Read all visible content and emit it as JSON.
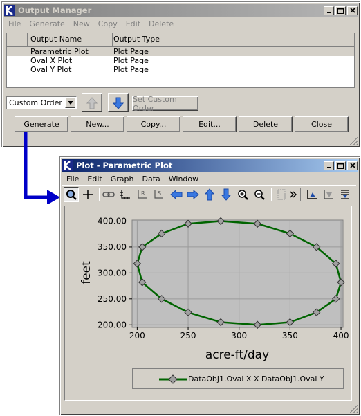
{
  "output_manager": {
    "title": "Output Manager",
    "menu": [
      "File",
      "Generate",
      "New",
      "Copy",
      "Edit",
      "Delete"
    ],
    "table": {
      "headers": [
        "Output Name",
        "Output Type"
      ],
      "rows": [
        {
          "name": "Parametric Plot",
          "type": "Plot Page"
        },
        {
          "name": "Oval X Plot",
          "type": "Plot Page"
        },
        {
          "name": "Oval Y Plot",
          "type": "Plot Page"
        }
      ]
    },
    "order_select": "Custom Order",
    "set_custom_order": "Set Custom Order",
    "buttons": {
      "generate": "Generate",
      "new": "New...",
      "copy": "Copy...",
      "edit": "Edit...",
      "delete": "Delete",
      "close": "Close"
    }
  },
  "plot_window": {
    "title": "Plot - Parametric Plot",
    "menu": [
      "File",
      "Edit",
      "Graph",
      "Data",
      "Window"
    ]
  },
  "chart_data": {
    "type": "line",
    "xlabel": "acre-ft/day",
    "ylabel": "feet",
    "xlim": [
      195,
      402
    ],
    "ylim": [
      195,
      402
    ],
    "xticks": [
      "200",
      "250",
      "300",
      "350",
      "400"
    ],
    "yticks": [
      "400.00",
      "350.00",
      "300.00",
      "250.00",
      "200.00"
    ],
    "grid": true,
    "legend_position": "bottom",
    "series": [
      {
        "name": "DataObj1.Oval X X DataObj1.Oval Y",
        "color": "#006400",
        "marker": "diamond",
        "x": [
          400,
          395,
          376,
          350,
          318,
          282,
          250,
          224,
          205,
          200,
          205,
          224,
          250,
          282,
          318,
          350,
          376,
          395,
          400
        ],
        "y": [
          282,
          318,
          350,
          376,
          395,
          400,
          395,
          376,
          350,
          318,
          282,
          250,
          224,
          205,
          200,
          205,
          224,
          250,
          282
        ]
      }
    ]
  }
}
